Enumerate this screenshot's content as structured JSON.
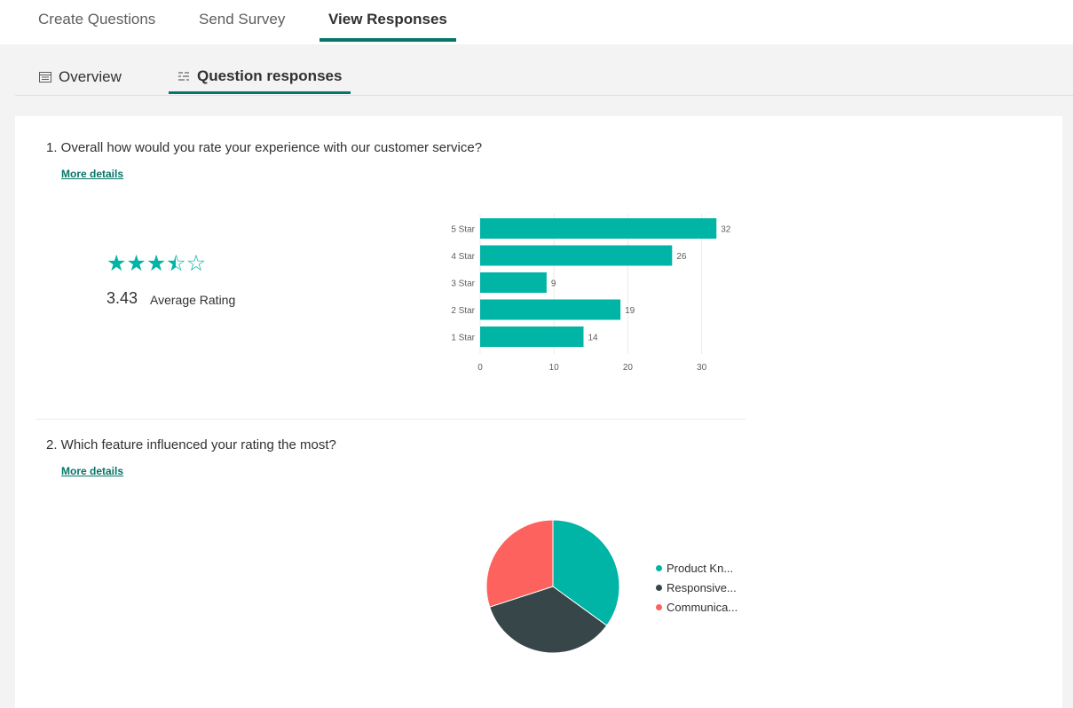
{
  "top_nav": {
    "tabs": [
      {
        "label": "Create Questions"
      },
      {
        "label": "Send Survey"
      },
      {
        "label": "View Responses"
      }
    ]
  },
  "sub_nav": {
    "tabs": [
      {
        "label": "Overview",
        "icon": "overview-icon"
      },
      {
        "label": "Question responses",
        "icon": "question-responses-icon"
      }
    ]
  },
  "questions": [
    {
      "title": "1. Overall how would you rate your experience with our customer service?",
      "more_details": "More details",
      "average_rating": "3.43",
      "average_label": "Average Rating",
      "star_rating": 3.43
    },
    {
      "title": "2. Which feature influenced your rating the most?",
      "more_details": "More details",
      "legend": [
        {
          "label": "Product Kn...",
          "color": "#00b4a6"
        },
        {
          "label": "Responsive...",
          "color": "#374649"
        },
        {
          "label": "Communica...",
          "color": "#fd625e"
        }
      ]
    }
  ],
  "colors": {
    "accent": "#077568",
    "teal": "#00b4a6",
    "dark": "#374649",
    "red": "#fd625e"
  },
  "chart_data": [
    {
      "type": "bar",
      "orientation": "horizontal",
      "categories": [
        "5 Star",
        "4 Star",
        "3 Star",
        "2 Star",
        "1 Star"
      ],
      "values": [
        32,
        26,
        9,
        19,
        14
      ],
      "xlim": [
        0,
        32
      ],
      "xticks": [
        0,
        10,
        20,
        30
      ],
      "grid": true,
      "color": "#00b4a6"
    },
    {
      "type": "pie",
      "categories": [
        "Product Kn...",
        "Responsive...",
        "Communica..."
      ],
      "values": [
        35,
        35,
        30
      ],
      "colors": [
        "#00b4a6",
        "#374649",
        "#fd625e"
      ]
    }
  ]
}
